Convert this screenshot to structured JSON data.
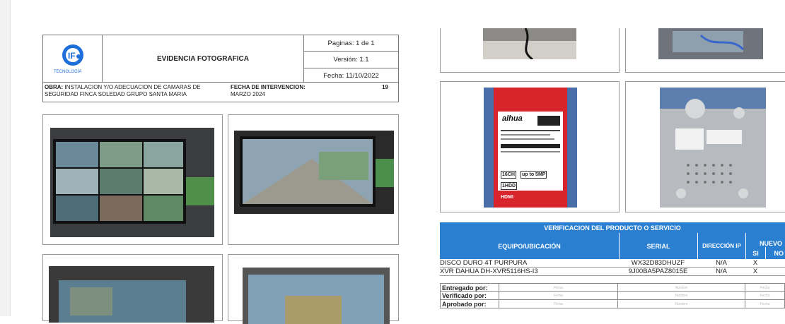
{
  "header": {
    "logo_text": "TECNOLOGÍA",
    "title": "EVIDENCIA FOTOGRAFICA",
    "pages": "Paginas: 1 de 1",
    "version": "Versión: 1.1",
    "date": "Fecha: 11/10/2022",
    "obra_label": "OBRA:",
    "obra_text": "INSTALACION Y/O ADECUACION DE CAMARAS DE SEGURIDAD FINCA SOLEDAD GRUPO SANTA MARIA",
    "fecha_label": "FECHA DE INTERVENCION:",
    "fecha_value": "MARZO 2024",
    "number": "19"
  },
  "box_label": {
    "brand": "alhua",
    "l1": "16CH",
    "l2": "up to 5MP",
    "l3": "1HDD",
    "l4": "HDMI"
  },
  "verification": {
    "title": "VERIFICACION DEL PRODUCTO O SERVICIO",
    "columns": [
      "EQUIPO/UBICACIÓN",
      "SERIAL",
      "DIRECCIÓN IP",
      "NUEVO",
      "SI",
      "NO"
    ],
    "rows": [
      {
        "equipo": "DISCO DURO 4T PURPURA",
        "serial": "WX32D83DHUZF",
        "ip": "N/A",
        "si": "X"
      },
      {
        "equipo": "XVR DAHUA DH-XVR5116HS-I3",
        "serial": "9J00BA5PAZ8015E",
        "ip": "N/A",
        "si": "X"
      }
    ],
    "signoff": [
      {
        "label": "Entregado por:"
      },
      {
        "label": "Verificado por:"
      },
      {
        "label": "Aprobado por:"
      }
    ],
    "sign_cols": [
      "Firma",
      "Nombre",
      "Fecha"
    ]
  }
}
